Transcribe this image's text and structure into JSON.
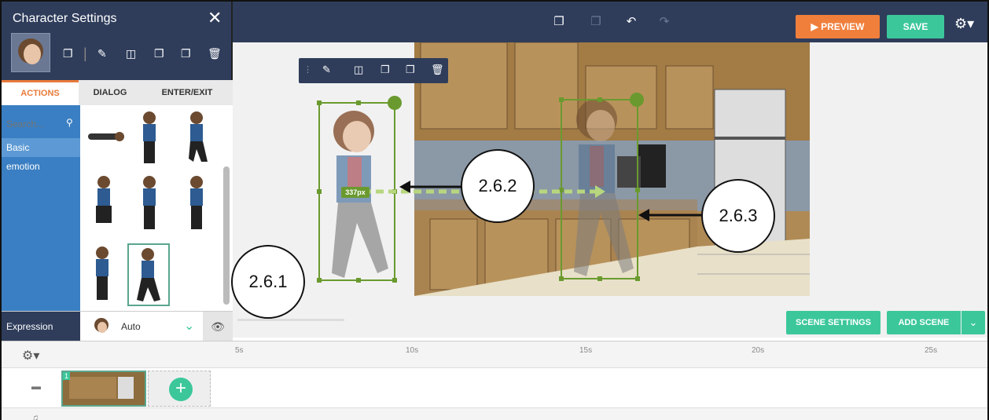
{
  "topbar": {
    "preview_label": "PREVIEW",
    "save_label": "SAVE"
  },
  "panel": {
    "title": "Character Settings",
    "tabs": [
      "ACTIONS",
      "DIALOG",
      "ENTER/EXIT"
    ],
    "search_placeholder": "Search...",
    "categories": [
      "Basic",
      "emotion"
    ],
    "expression_label": "Expression",
    "expression_value": "Auto"
  },
  "canvas": {
    "distance_badge": "337px"
  },
  "scene_buttons": {
    "scene_settings": "SCENE SETTINGS",
    "add_scene": "ADD SCENE"
  },
  "timeline": {
    "ticks": [
      "5s",
      "10s",
      "15s",
      "20s",
      "25s"
    ],
    "scene_number": "1"
  },
  "callouts": [
    "2.6.1",
    "2.6.2",
    "2.6.3"
  ],
  "colors": {
    "navy": "#2f3d5b",
    "orange": "#f07f3c",
    "green": "#3cc79b",
    "blue": "#3a7fc3",
    "selection": "#6a9a2f"
  }
}
